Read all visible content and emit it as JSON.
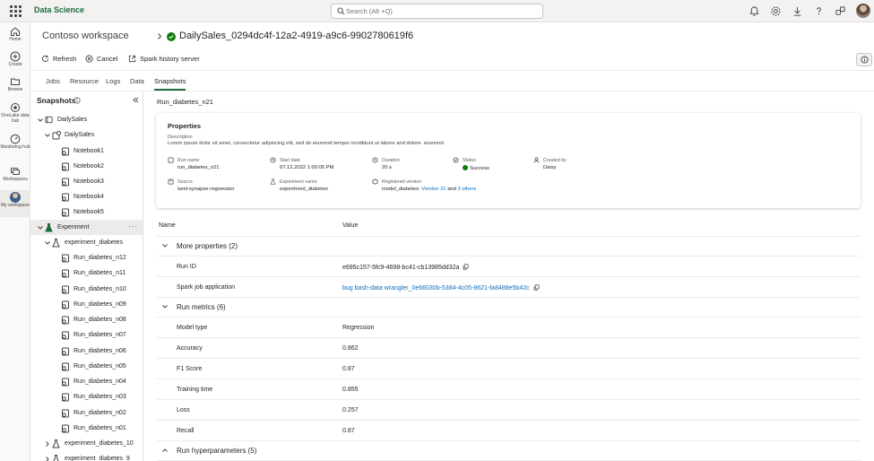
{
  "app": {
    "name": "Data Science"
  },
  "search": {
    "placeholder": "Search (Alt +Q)"
  },
  "leftnav": [
    {
      "label": "Home",
      "icon": "home-icon"
    },
    {
      "label": "Create",
      "icon": "create-icon"
    },
    {
      "label": "Browse",
      "icon": "browse-icon"
    },
    {
      "label": "OneLake data hub",
      "icon": "onelake-icon"
    },
    {
      "label": "Monitoring hub",
      "icon": "monitoring-icon"
    },
    {
      "label": "Workspaces",
      "icon": "workspaces-icon"
    },
    {
      "label": "My workspace",
      "icon": "my-workspace-avatar"
    }
  ],
  "header": {
    "workspace": "Contoso workspace",
    "title": "DailySales_0294dc4f-12a2-4919-a9c6-9902780619f6",
    "status_color": "#107c10"
  },
  "toolbar": {
    "refresh": "Refresh",
    "cancel": "Cancel",
    "spark": "Spark history server"
  },
  "tabs": [
    "Jobs",
    "Resource",
    "Logs",
    "Data",
    "Snapshots"
  ],
  "active_tab": "Snapshots",
  "tree": {
    "title": "Snapshots",
    "root": "DailySales",
    "folder": "DailySales",
    "notebooks": [
      "Notebook1",
      "Notebook2",
      "Notebook3",
      "Notebook4",
      "Notebook5"
    ],
    "experiment": "Experiment",
    "experiment_item": "experiment_diabetes",
    "runs": [
      "Run_diabetes_n12",
      "Run_diabetes_n11",
      "Run_diabetes_n10",
      "Run_diabetes_n09",
      "Run_diabetes_n08",
      "Run_diabetes_n07",
      "Run_diabetes_n06",
      "Run_diabetes_n05",
      "Run_diabetes_n04",
      "Run_diabetes_n03",
      "Run_diabetes_n02",
      "Run_diabetes_n01"
    ],
    "more_experiments": [
      "experiment_diabetes_10",
      "experiment_diabetes_9"
    ]
  },
  "main": {
    "run_title": "Run_diabetes_n21",
    "properties": {
      "heading": "Properties",
      "desc_label": "Description",
      "desc": "Lorem ipsum dolor sit amet, consectetur adipiscing elit, sed do eiusmod tempor incididunt ut labore and dolore. eiusmod.",
      "run_name_label": "Run name",
      "run_name": "run_diabetes_n21",
      "start_label": "Start date",
      "start": "07.12.2022 1:00:05 PM",
      "duration_label": "Duration",
      "duration": "20 s",
      "status_label": "Status",
      "status": "Success",
      "created_label": "Created by",
      "created": "Daisy",
      "source_label": "Source",
      "source": "taml-synapse-regression",
      "exp_label": "Experiment name",
      "exp": "experiment_diabetes",
      "reg_label": "Registered version",
      "reg_prefix": "model_diabetes:",
      "reg_version": "Version 31",
      "reg_and": "and",
      "reg_others": "3 others"
    },
    "table": {
      "col_name": "Name",
      "col_value": "Value",
      "more_props": "More properties (2)",
      "run_id_k": "Run ID",
      "run_id_v": "e695c157-5fc9-4698-bc41-cb13985dd32a",
      "spark_k": "Spark job application",
      "spark_v": "bug bash-data wrangler_0e66030b-5384-4c05-8621-fa8488e5b42c",
      "metrics": "Run metrics (6)",
      "metric_rows": [
        {
          "k": "Model type",
          "v": "Regression"
        },
        {
          "k": "Accuracy",
          "v": "0.862"
        },
        {
          "k": "F1 Score",
          "v": "0.87"
        },
        {
          "k": "Training time",
          "v": "0.855"
        },
        {
          "k": "Loss",
          "v": "0.257"
        },
        {
          "k": "Recall",
          "v": "0.87"
        }
      ],
      "hyper": "Run hyperparameters (5)"
    }
  }
}
